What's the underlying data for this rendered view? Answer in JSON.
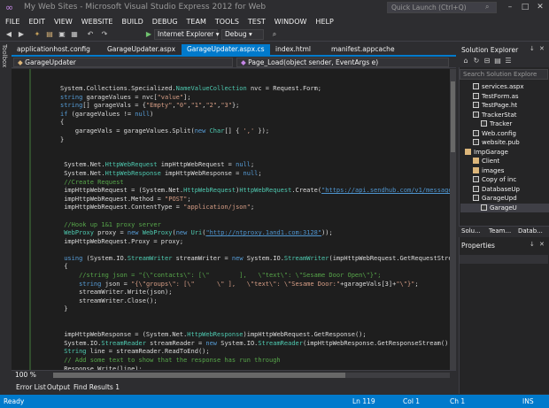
{
  "window": {
    "title": "My Web Sites - Microsoft Visual Studio Express 2012 for Web",
    "quick_launch_placeholder": "Quick Launch (Ctrl+Q)"
  },
  "menu": [
    "FILE",
    "EDIT",
    "VIEW",
    "WEBSITE",
    "BUILD",
    "DEBUG",
    "TEAM",
    "TOOLS",
    "TEST",
    "WINDOW",
    "HELP"
  ],
  "toolbar": {
    "browser": "Internet Explorer",
    "config": "Debug"
  },
  "toolbox_label": "Toolbox",
  "doc_tabs": [
    {
      "label": "applicationhost.config",
      "active": false
    },
    {
      "label": "GarageUpdater.aspx",
      "active": false
    },
    {
      "label": "GarageUpdater.aspx.cs",
      "active": true
    },
    {
      "label": "index.html",
      "active": false
    },
    {
      "label": "manifest.appcache",
      "active": false
    }
  ],
  "nav": {
    "class_combo": "GarageUpdater",
    "member_combo": "Page_Load(object sender, EventArgs e)"
  },
  "code_lines": [
    [
      [
        "System.Collections.Specialized.",
        ""
      ],
      [
        "NameValueCollection",
        "ty"
      ],
      [
        " nvc = Request.Form;",
        ""
      ]
    ],
    [
      [
        "string",
        "kw"
      ],
      [
        " garageValues = nvc[",
        ""
      ],
      [
        "\"value\"",
        "st"
      ],
      [
        "];",
        ""
      ]
    ],
    [
      [
        "string",
        "kw"
      ],
      [
        "[] garageVals = {",
        ""
      ],
      [
        "\"Empty\"",
        "st"
      ],
      [
        ",",
        ""
      ],
      [
        "\"0\"",
        "st"
      ],
      [
        ",",
        ""
      ],
      [
        "\"1\"",
        "st"
      ],
      [
        ",",
        ""
      ],
      [
        "\"2\"",
        "st"
      ],
      [
        ",",
        ""
      ],
      [
        "\"3\"",
        "st"
      ],
      [
        "};",
        ""
      ]
    ],
    [
      [
        "if",
        "kw"
      ],
      [
        " (garageValues != ",
        ""
      ],
      [
        "null",
        "kw"
      ],
      [
        ")",
        ""
      ]
    ],
    [
      [
        "{",
        ""
      ]
    ],
    [
      [
        "    garageVals = garageValues.Split(",
        ""
      ],
      [
        "new",
        "kw"
      ],
      [
        " ",
        ""
      ],
      [
        "Char",
        "ty"
      ],
      [
        "[] { ",
        ""
      ],
      [
        "','",
        "st"
      ],
      [
        " });",
        ""
      ]
    ],
    [
      [
        "}",
        ""
      ]
    ],
    [
      [
        "",
        ""
      ]
    ],
    [
      [
        "",
        ""
      ]
    ],
    [
      [
        " System.Net.",
        ""
      ],
      [
        "HttpWebRequest",
        "ty"
      ],
      [
        " impHttpWebRequest = ",
        ""
      ],
      [
        "null",
        "kw"
      ],
      [
        ";",
        ""
      ]
    ],
    [
      [
        " System.Net.",
        ""
      ],
      [
        "HttpWebResponse",
        "ty"
      ],
      [
        " impHttpWebResponse = ",
        ""
      ],
      [
        "null",
        "kw"
      ],
      [
        ";",
        ""
      ]
    ],
    [
      [
        " //Create Request",
        "cm"
      ]
    ],
    [
      [
        " impHttpWebRequest = (System.Net.",
        ""
      ],
      [
        "HttpWebRequest",
        "ty"
      ],
      [
        ")",
        ""
      ],
      [
        "HttpWebRequest",
        "ty"
      ],
      [
        ".Create(",
        ""
      ],
      [
        "\"https://api.sendhub.com/v1/messages",
        "ln"
      ]
    ],
    [
      [
        " impHttpWebRequest.Method = ",
        ""
      ],
      [
        "\"POST\"",
        "st"
      ],
      [
        ";",
        ""
      ]
    ],
    [
      [
        " impHttpWebRequest.ContentType = ",
        ""
      ],
      [
        "\"application/json\"",
        "st"
      ],
      [
        ";",
        ""
      ]
    ],
    [
      [
        "",
        ""
      ]
    ],
    [
      [
        " //Hook up 1&1 proxy server",
        "cm"
      ]
    ],
    [
      [
        " ",
        ""
      ],
      [
        "WebProxy",
        "ty"
      ],
      [
        " proxy = ",
        ""
      ],
      [
        "new",
        "kw"
      ],
      [
        " ",
        ""
      ],
      [
        "WebProxy",
        "ty"
      ],
      [
        "(",
        ""
      ],
      [
        "new",
        "kw"
      ],
      [
        " ",
        ""
      ],
      [
        "Uri",
        "ty"
      ],
      [
        "(",
        ""
      ],
      [
        "\"http://ntproxy.1and1.com:3128\"",
        "ln"
      ],
      [
        "));",
        ""
      ]
    ],
    [
      [
        " impHttpWebRequest.Proxy = proxy;",
        ""
      ]
    ],
    [
      [
        "",
        ""
      ]
    ],
    [
      [
        " ",
        ""
      ],
      [
        "using",
        "kw"
      ],
      [
        " (System.IO.",
        ""
      ],
      [
        "StreamWriter",
        "ty"
      ],
      [
        " streamWriter = ",
        ""
      ],
      [
        "new",
        "kw"
      ],
      [
        " System.IO.",
        ""
      ],
      [
        "StreamWriter",
        "ty"
      ],
      [
        "(impHttpWebRequest.GetRequestStre",
        ""
      ]
    ],
    [
      [
        " {",
        ""
      ]
    ],
    [
      [
        "     //string json = \"{\\\"contacts\\\": [\\\"        ],   \\\"text\\\": \\\"Sesame Door Open\\\"}\";",
        "cm"
      ]
    ],
    [
      [
        "     ",
        ""
      ],
      [
        "string",
        "kw"
      ],
      [
        " json = ",
        ""
      ],
      [
        "\"{\\\"groups\\\": [\\\"      \\\" ],   \\\"text\\\": \\\"Sesame Door:\"",
        "st"
      ],
      [
        "+garageVals[3]+",
        ""
      ],
      [
        "\"\\\"}\"",
        "st"
      ],
      [
        ";",
        ""
      ]
    ],
    [
      [
        "     streamWriter.Write(json);",
        ""
      ]
    ],
    [
      [
        "     streamWriter.Close();",
        ""
      ]
    ],
    [
      [
        " }",
        ""
      ]
    ],
    [
      [
        "",
        ""
      ]
    ],
    [
      [
        "",
        ""
      ]
    ],
    [
      [
        " impHttpWebResponse = (System.Net.",
        ""
      ],
      [
        "HttpWebResponse",
        "ty"
      ],
      [
        ")impHttpWebRequest.GetResponse();",
        ""
      ]
    ],
    [
      [
        " System.IO.",
        ""
      ],
      [
        "StreamReader",
        "ty"
      ],
      [
        " streamReader = ",
        ""
      ],
      [
        "new",
        "kw"
      ],
      [
        " System.IO.",
        ""
      ],
      [
        "StreamReader",
        "ty"
      ],
      [
        "(impHttpWebResponse.GetResponseStream()",
        ""
      ]
    ],
    [
      [
        " ",
        ""
      ],
      [
        "String",
        "ty"
      ],
      [
        " line = streamReader.ReadToEnd();",
        ""
      ]
    ],
    [
      [
        " // Add some text to show that the response has run through",
        "cm"
      ]
    ],
    [
      [
        " Response.Write(line);",
        ""
      ]
    ]
  ],
  "editor": {
    "zoom": "100 %"
  },
  "bottom_tabs": [
    "Error List",
    "Output",
    "Find Results 1"
  ],
  "status": {
    "left": "Ready",
    "line": "Ln 119",
    "col": "Col 1",
    "ch": "Ch 1",
    "mode": "INS"
  },
  "solution_explorer": {
    "title": "Solution Explorer",
    "search_placeholder": "Search Solution Explore",
    "items": [
      {
        "label": "services.aspx",
        "indent": 2,
        "icon": "file"
      },
      {
        "label": "TestForm.as",
        "indent": 2,
        "icon": "file"
      },
      {
        "label": "TestPage.ht",
        "indent": 2,
        "icon": "file"
      },
      {
        "label": "TrackerStat",
        "indent": 2,
        "icon": "file"
      },
      {
        "label": "Tracker",
        "indent": 3,
        "icon": "file"
      },
      {
        "label": "Web.config",
        "indent": 2,
        "icon": "file"
      },
      {
        "label": "website.pub",
        "indent": 2,
        "icon": "file"
      },
      {
        "label": "ImpGarage",
        "indent": 1,
        "icon": "folder"
      },
      {
        "label": "Client",
        "indent": 2,
        "icon": "folder"
      },
      {
        "label": "images",
        "indent": 2,
        "icon": "folder"
      },
      {
        "label": "Copy of inc",
        "indent": 2,
        "icon": "file"
      },
      {
        "label": "DatabaseUp",
        "indent": 2,
        "icon": "file"
      },
      {
        "label": "GarageUpd",
        "indent": 2,
        "icon": "file"
      },
      {
        "label": "GarageU",
        "indent": 3,
        "icon": "file",
        "selected": true
      }
    ],
    "tabs": [
      "Solu...",
      "Team...",
      "Datab..."
    ]
  },
  "properties": {
    "title": "Properties"
  },
  "colors": {
    "accent": "#007acc",
    "background": "#2d2d30",
    "editor": "#1e1e1e"
  }
}
